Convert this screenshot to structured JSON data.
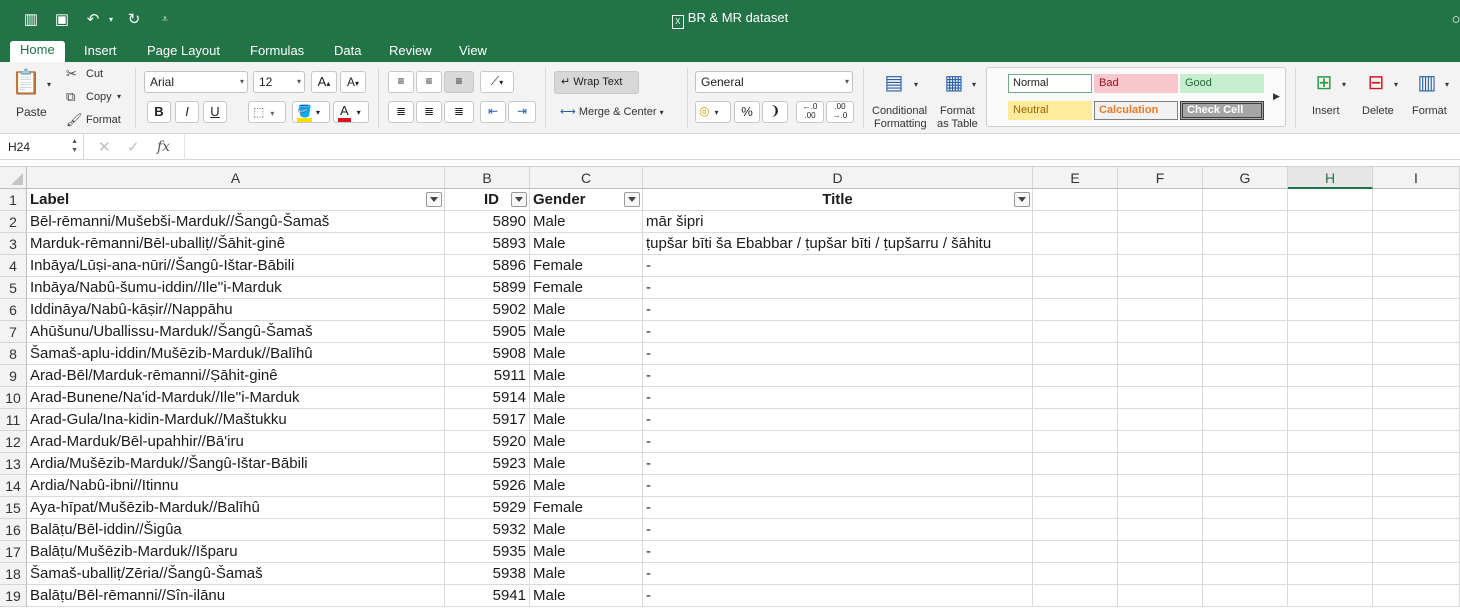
{
  "window": {
    "title": "BR & MR dataset"
  },
  "tabs": [
    "Home",
    "Insert",
    "Page Layout",
    "Formulas",
    "Data",
    "Review",
    "View"
  ],
  "ribbon": {
    "paste": "Paste",
    "cut": "Cut",
    "copy": "Copy",
    "format_painter": "Format",
    "font_name": "Arial",
    "font_size": "12",
    "bold": "B",
    "italic": "I",
    "underline": "U",
    "wrap_text": "Wrap Text",
    "merge_center": "Merge & Center",
    "number_format": "General",
    "percent": "%",
    "conditional_formatting_1": "Conditional",
    "conditional_formatting_2": "Formatting",
    "format_as_table_1": "Format",
    "format_as_table_2": "as Table",
    "styles": {
      "normal": "Normal",
      "bad": "Bad",
      "good": "Good",
      "neutral": "Neutral",
      "calculation": "Calculation",
      "check_cell": "Check Cell"
    },
    "insert": "Insert",
    "delete": "Delete",
    "format": "Format"
  },
  "formula_bar": {
    "name_box": "H24",
    "fx": "fx",
    "value": ""
  },
  "columns": [
    "A",
    "B",
    "C",
    "D",
    "E",
    "F",
    "G",
    "H",
    "I"
  ],
  "selected_column": "H",
  "header_row": {
    "label": "Label",
    "id": "ID",
    "gender": "Gender",
    "title": "Title"
  },
  "rows": [
    {
      "n": "2",
      "label": "Bēl-rēmanni/Mušebši-Marduk//Šangû-Šamaš",
      "id": "5890",
      "gender": "Male",
      "title": "mār šipri"
    },
    {
      "n": "3",
      "label": "Marduk-rēmanni/Bēl-uballiṭ//Šāhit-ginê",
      "id": "5893",
      "gender": "Male",
      "title": "ṭupšar bīti ša Ebabbar / ṭupšar bīti / ṭupšarru / šāhitu"
    },
    {
      "n": "4",
      "label": "Inbāya/Lūṣi-ana-nūri//Šangû-Ištar-Bābili",
      "id": "5896",
      "gender": "Female",
      "title": "-"
    },
    {
      "n": "5",
      "label": "Inbāya/Nabû-šumu-iddin//Ile''i-Marduk",
      "id": "5899",
      "gender": "Female",
      "title": "-"
    },
    {
      "n": "6",
      "label": "Iddināya/Nabû-kāṣir//Nappāhu",
      "id": "5902",
      "gender": "Male",
      "title": "-"
    },
    {
      "n": "7",
      "label": "Ahūšunu/Uballissu-Marduk//Šangû-Šamaš",
      "id": "5905",
      "gender": "Male",
      "title": "-"
    },
    {
      "n": "8",
      "label": "Šamaš-aplu-iddin/Mušēzib-Marduk//Balīhû",
      "id": "5908",
      "gender": "Male",
      "title": "-"
    },
    {
      "n": "9",
      "label": "Arad-Bēl/Marduk-rēmanni//Ṣāhit-ginê",
      "id": "5911",
      "gender": "Male",
      "title": "-"
    },
    {
      "n": "10",
      "label": "Arad-Bunene/Na'id-Marduk//Ile''i-Marduk",
      "id": "5914",
      "gender": "Male",
      "title": "-"
    },
    {
      "n": "11",
      "label": "Arad-Gula/Ina-kidin-Marduk//Maštukku",
      "id": "5917",
      "gender": "Male",
      "title": "-"
    },
    {
      "n": "12",
      "label": "Arad-Marduk/Bēl-upahhir//Bā'iru",
      "id": "5920",
      "gender": "Male",
      "title": "-"
    },
    {
      "n": "13",
      "label": "Ardia/Mušēzib-Marduk//Šangû-Ištar-Bābili",
      "id": "5923",
      "gender": "Male",
      "title": "-"
    },
    {
      "n": "14",
      "label": "Ardia/Nabû-ibni//Itinnu",
      "id": "5926",
      "gender": "Male",
      "title": "-"
    },
    {
      "n": "15",
      "label": "Aya-hīpat/Mušēzib-Marduk//Balīhû",
      "id": "5929",
      "gender": "Female",
      "title": "-"
    },
    {
      "n": "16",
      "label": "Balāṭu/Bēl-iddin//Šigûa",
      "id": "5932",
      "gender": "Male",
      "title": "-"
    },
    {
      "n": "17",
      "label": "Balāṭu/Mušēzib-Marduk//Išparu",
      "id": "5935",
      "gender": "Male",
      "title": "-"
    },
    {
      "n": "18",
      "label": "Šamaš-uballiṭ/Zēria//Šangû-Šamaš",
      "id": "5938",
      "gender": "Male",
      "title": "-"
    },
    {
      "n": "19",
      "label": "Balāṭu/Bēl-rēmanni//Sîn-ilānu",
      "id": "5941",
      "gender": "Male",
      "title": "-"
    }
  ]
}
